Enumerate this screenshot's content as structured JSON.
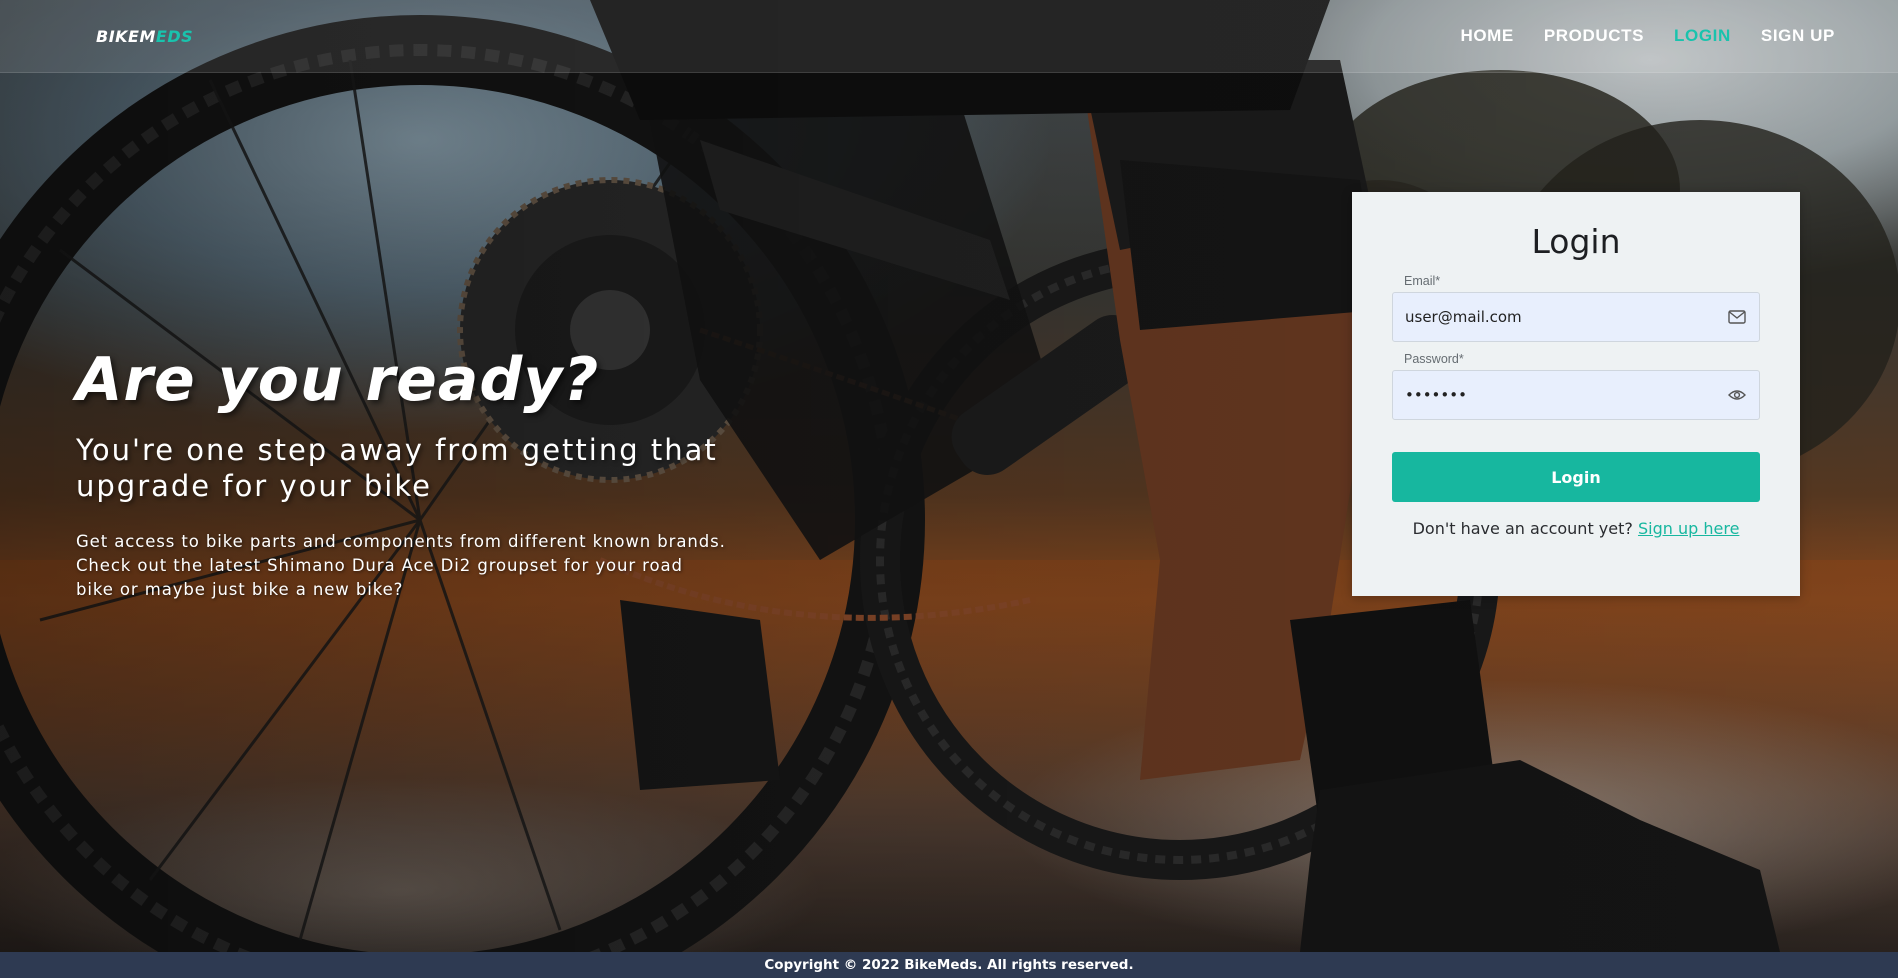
{
  "brand": {
    "logo_part1": "BIKEM",
    "logo_part2": "EDS",
    "accent_color": "#19c3ad"
  },
  "nav": {
    "items": [
      {
        "label": "HOME",
        "active": false
      },
      {
        "label": "PRODUCTS",
        "active": false
      },
      {
        "label": "LOGIN",
        "active": true
      },
      {
        "label": "SIGN UP",
        "active": false
      }
    ]
  },
  "hero": {
    "title": "Are you ready?",
    "subtitle_line1": "You're one step away from getting that",
    "subtitle_line2": "upgrade for your bike",
    "description": "Get access to bike parts and components from different known brands. Check out the latest Shimano Dura Ace Di2 groupset for your road bike or maybe just bike a new bike?"
  },
  "login": {
    "title": "Login",
    "email_label": "Email*",
    "email_value": "user@mail.com",
    "email_icon": "envelope-icon",
    "password_label": "Password*",
    "password_value": "•••••••",
    "password_icon": "eye-icon",
    "button_label": "Login",
    "signup_prompt": "Don't have an account yet?",
    "signup_link": "Sign up here",
    "button_color": "#17b79f"
  },
  "footer": {
    "text": "Copyright © 2022 BikeMeds. All rights reserved.",
    "background": "#2e3a52"
  }
}
